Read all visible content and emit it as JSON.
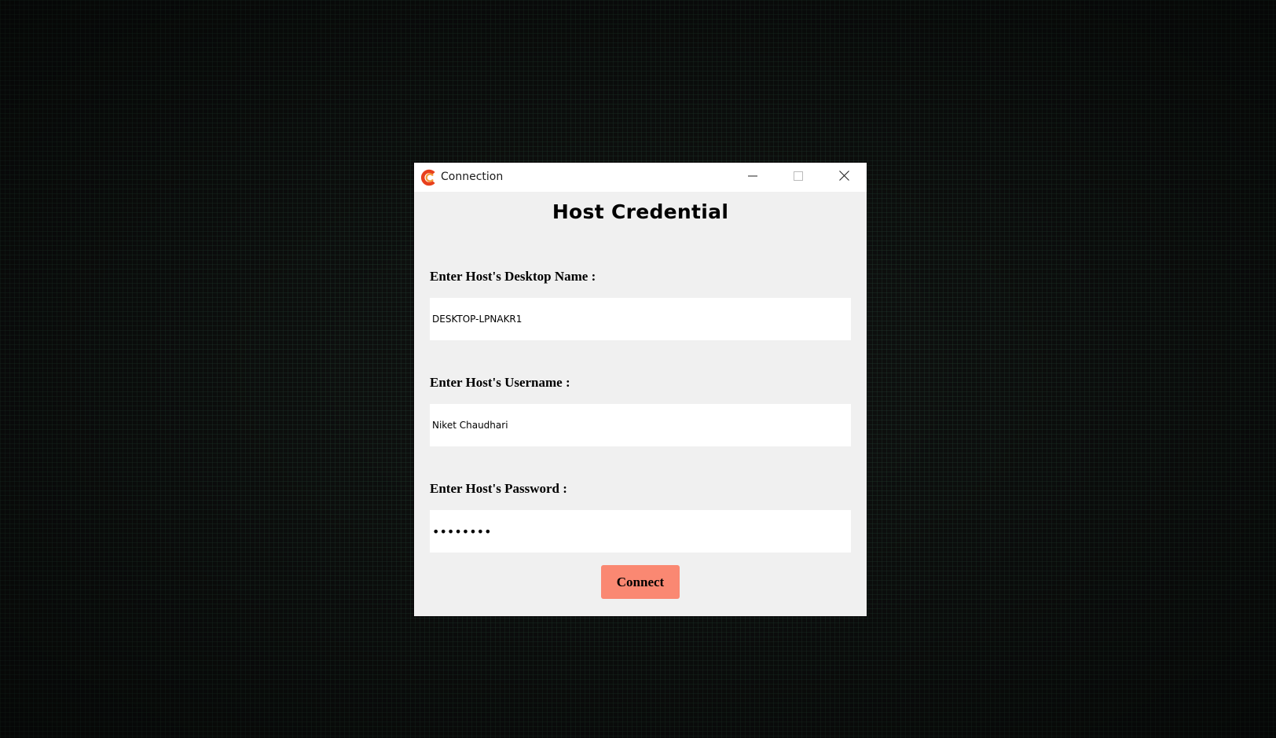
{
  "window": {
    "title": "Connection",
    "app_icon": "c-logo-icon",
    "controls": [
      "minimize-icon",
      "maximize-icon",
      "close-icon"
    ]
  },
  "form": {
    "heading": "Host Credential",
    "desktop_name": {
      "label": "Enter Host's Desktop Name :",
      "value": "DESKTOP-LPNAKR1"
    },
    "username": {
      "label": "Enter Host's Username :",
      "value": "Niket Chaudhari"
    },
    "password": {
      "label": "Enter Host's Password :",
      "value": "abcdefgh"
    },
    "connect_label": "Connect"
  },
  "colors": {
    "accent": "#fa8872",
    "window_bg": "#f0f0f0",
    "desktop_bg": "#0d0f0e"
  }
}
